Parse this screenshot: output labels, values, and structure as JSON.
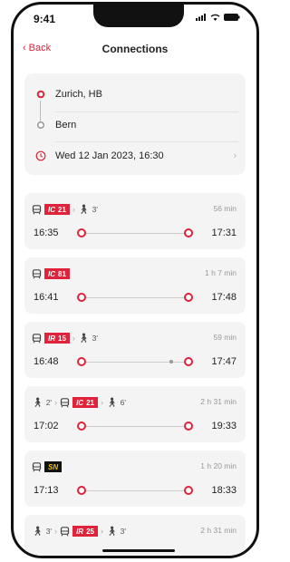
{
  "status": {
    "time": "9:41"
  },
  "nav": {
    "back_label": "Back",
    "title": "Connections"
  },
  "route": {
    "from": "Zurich, HB",
    "to": "Bern",
    "datetime": "Wed 12 Jan 2023, 16:30"
  },
  "connections": [
    {
      "segments": [
        {
          "type": "train",
          "prefix": "IC",
          "number": "21"
        },
        {
          "type": "walk",
          "minutes": "3'"
        }
      ],
      "duration": "56 min",
      "dep": "16:35",
      "arr": "17:31"
    },
    {
      "segments": [
        {
          "type": "train",
          "prefix": "IC",
          "number": "81"
        }
      ],
      "duration": "1 h 7 min",
      "dep": "16:41",
      "arr": "17:48"
    },
    {
      "segments": [
        {
          "type": "train",
          "prefix": "IR",
          "number": "15"
        },
        {
          "type": "walk",
          "minutes": "3'"
        }
      ],
      "duration": "59 min",
      "dep": "16:48",
      "arr": "17:47"
    },
    {
      "segments": [
        {
          "type": "walk",
          "minutes": "2'"
        },
        {
          "type": "train",
          "prefix": "IC",
          "number": "21"
        },
        {
          "type": "walk",
          "minutes": "6'"
        }
      ],
      "duration": "2 h 31 min",
      "dep": "17:02",
      "arr": "19:33"
    },
    {
      "segments": [
        {
          "type": "train",
          "prefix": "SN",
          "number": ""
        }
      ],
      "duration": "1 h 20 min",
      "dep": "17:13",
      "arr": "18:33"
    },
    {
      "segments": [
        {
          "type": "walk",
          "minutes": "3'"
        },
        {
          "type": "train",
          "prefix": "IR",
          "number": "25"
        },
        {
          "type": "walk",
          "minutes": "3'"
        }
      ],
      "duration": "2 h 31 min",
      "dep": "",
      "arr": ""
    }
  ],
  "colors": {
    "accent": "#e0223a",
    "card": "#f4f4f5"
  }
}
